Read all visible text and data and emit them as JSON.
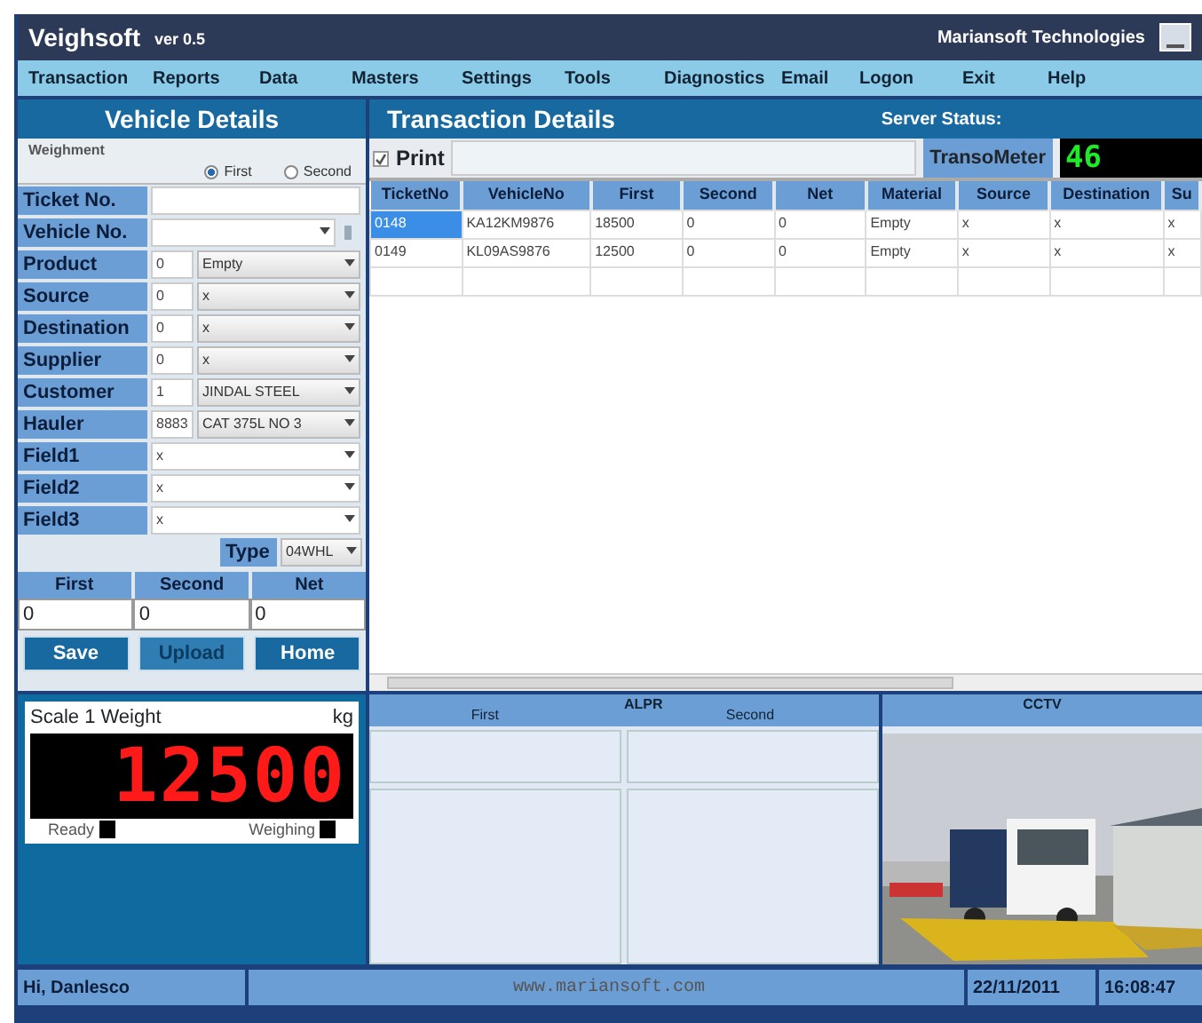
{
  "window": {
    "title": "Veighsoft",
    "version": "ver 0.5",
    "company": "Mariansoft Technologies"
  },
  "menu": [
    "Transaction",
    "Reports",
    "Data",
    "Masters",
    "Settings",
    "Tools",
    "Diagnostics",
    "Email",
    "Logon",
    "Exit",
    "Help"
  ],
  "vehicle_details": {
    "title": "Vehicle Details",
    "weighment": {
      "label": "Weighment",
      "options": [
        {
          "label": "First",
          "selected": true
        },
        {
          "label": "Second",
          "selected": false
        }
      ]
    },
    "fields": [
      {
        "kind": "text",
        "label": "Ticket No."
      },
      {
        "kind": "combo",
        "label": "Vehicle No."
      },
      {
        "kind": "coded",
        "label": "Product",
        "code": "0",
        "value": "Empty"
      },
      {
        "kind": "coded",
        "label": "Source",
        "code": "0",
        "value": "x"
      },
      {
        "kind": "coded",
        "label": "Destination",
        "code": "0",
        "value": "x"
      },
      {
        "kind": "coded",
        "label": "Supplier",
        "code": "0",
        "value": "x"
      },
      {
        "kind": "coded",
        "label": "Customer",
        "code": "1",
        "value": "JINDAL STEEL"
      },
      {
        "kind": "coded",
        "label": "Hauler",
        "code": "8883",
        "value": "CAT 375L NO 3"
      },
      {
        "kind": "select",
        "label": "Field1",
        "value": "x"
      },
      {
        "kind": "select",
        "label": "Field2",
        "value": "x"
      },
      {
        "kind": "select",
        "label": "Field3",
        "value": "x"
      }
    ],
    "type": {
      "label": "Type",
      "value": "04WHL"
    },
    "weights": [
      {
        "label": "First",
        "value": "0"
      },
      {
        "label": "Second",
        "value": "0"
      },
      {
        "label": "Net",
        "value": "0"
      }
    ],
    "buttons": [
      {
        "label": "Save",
        "disabled": false
      },
      {
        "label": "Upload",
        "disabled": true
      },
      {
        "label": "Home",
        "disabled": false
      }
    ]
  },
  "scale": {
    "title": "Scale 1 Weight",
    "unit": "kg",
    "reading": "12500",
    "indicators": [
      {
        "label": "Ready",
        "on": false
      },
      {
        "label": "Weighing",
        "on": false
      }
    ]
  },
  "transaction_details": {
    "title": "Transaction Details",
    "server_status": "Server Status:",
    "print": {
      "label": "Print",
      "checked": true
    },
    "meter": {
      "label": "TransoMeter",
      "value": "46"
    },
    "table": {
      "columns": [
        "TicketNo",
        "VehicleNo",
        "First",
        "Second",
        "Net",
        "Material",
        "Source",
        "Destination",
        "Su"
      ],
      "rows": [
        {
          "selected": true,
          "cells": [
            "0148",
            "KA12KM9876",
            "18500",
            "0",
            "0",
            "Empty",
            "x",
            "x",
            "x"
          ]
        },
        {
          "selected": false,
          "cells": [
            "0149",
            "KL09AS9876",
            "12500",
            "0",
            "0",
            "Empty",
            "x",
            "x",
            "x"
          ]
        }
      ]
    }
  },
  "alpr": {
    "title": "ALPR",
    "columns": [
      "First",
      "Second"
    ]
  },
  "cctv": {
    "title": "CCTV",
    "kind": "picture"
  },
  "status_bar": {
    "greeting": "Hi, Danlesco",
    "website": "www.mariansoft.com",
    "date": "22/11/2011",
    "time": "16:08:47"
  }
}
